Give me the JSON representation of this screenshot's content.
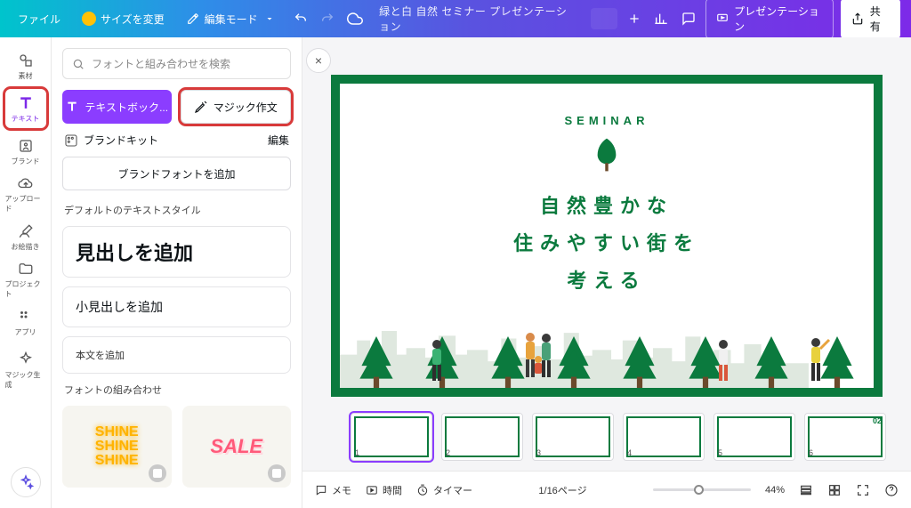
{
  "topbar": {
    "file": "ファイル",
    "resize": "サイズを変更",
    "editmode": "編集モード",
    "doc_title": "緑と白 自然 セミナー プレゼンテーション",
    "present": "プレゼンテーション",
    "share": "共有"
  },
  "sidebar": {
    "items": [
      {
        "label": "素材"
      },
      {
        "label": "テキスト"
      },
      {
        "label": "ブランド"
      },
      {
        "label": "アップロード"
      },
      {
        "label": "お絵描き"
      },
      {
        "label": "プロジェクト"
      },
      {
        "label": "アプリ"
      },
      {
        "label": "マジック生成"
      }
    ]
  },
  "panel": {
    "search_placeholder": "フォントと組み合わせを検索",
    "textbox": "テキストボック...",
    "magic_write": "マジック作文",
    "brandkit": "ブランドキット",
    "edit": "編集",
    "add_brand_font": "ブランドフォントを追加",
    "default_styles": "デフォルトのテキストスタイル",
    "add_heading": "見出しを追加",
    "add_subheading": "小見出しを追加",
    "add_body": "本文を追加",
    "font_combos": "フォントの組み合わせ",
    "combo1": "SHINE\nSHINE\nSHINE",
    "combo2": "SALE"
  },
  "slide": {
    "eyebrow": "SEMINAR",
    "title_l1": "自然豊かな",
    "title_l2": "住みやすい街を",
    "title_l3": "考える"
  },
  "thumbs": {
    "items": [
      {
        "n": "1"
      },
      {
        "n": "2"
      },
      {
        "n": "3"
      },
      {
        "n": "4"
      },
      {
        "n": "5"
      },
      {
        "n": "6"
      }
    ],
    "badge02": "02"
  },
  "bottombar": {
    "memo": "メモ",
    "duration": "時間",
    "timer": "タイマー",
    "page": "1/16ページ",
    "zoom": "44%"
  }
}
